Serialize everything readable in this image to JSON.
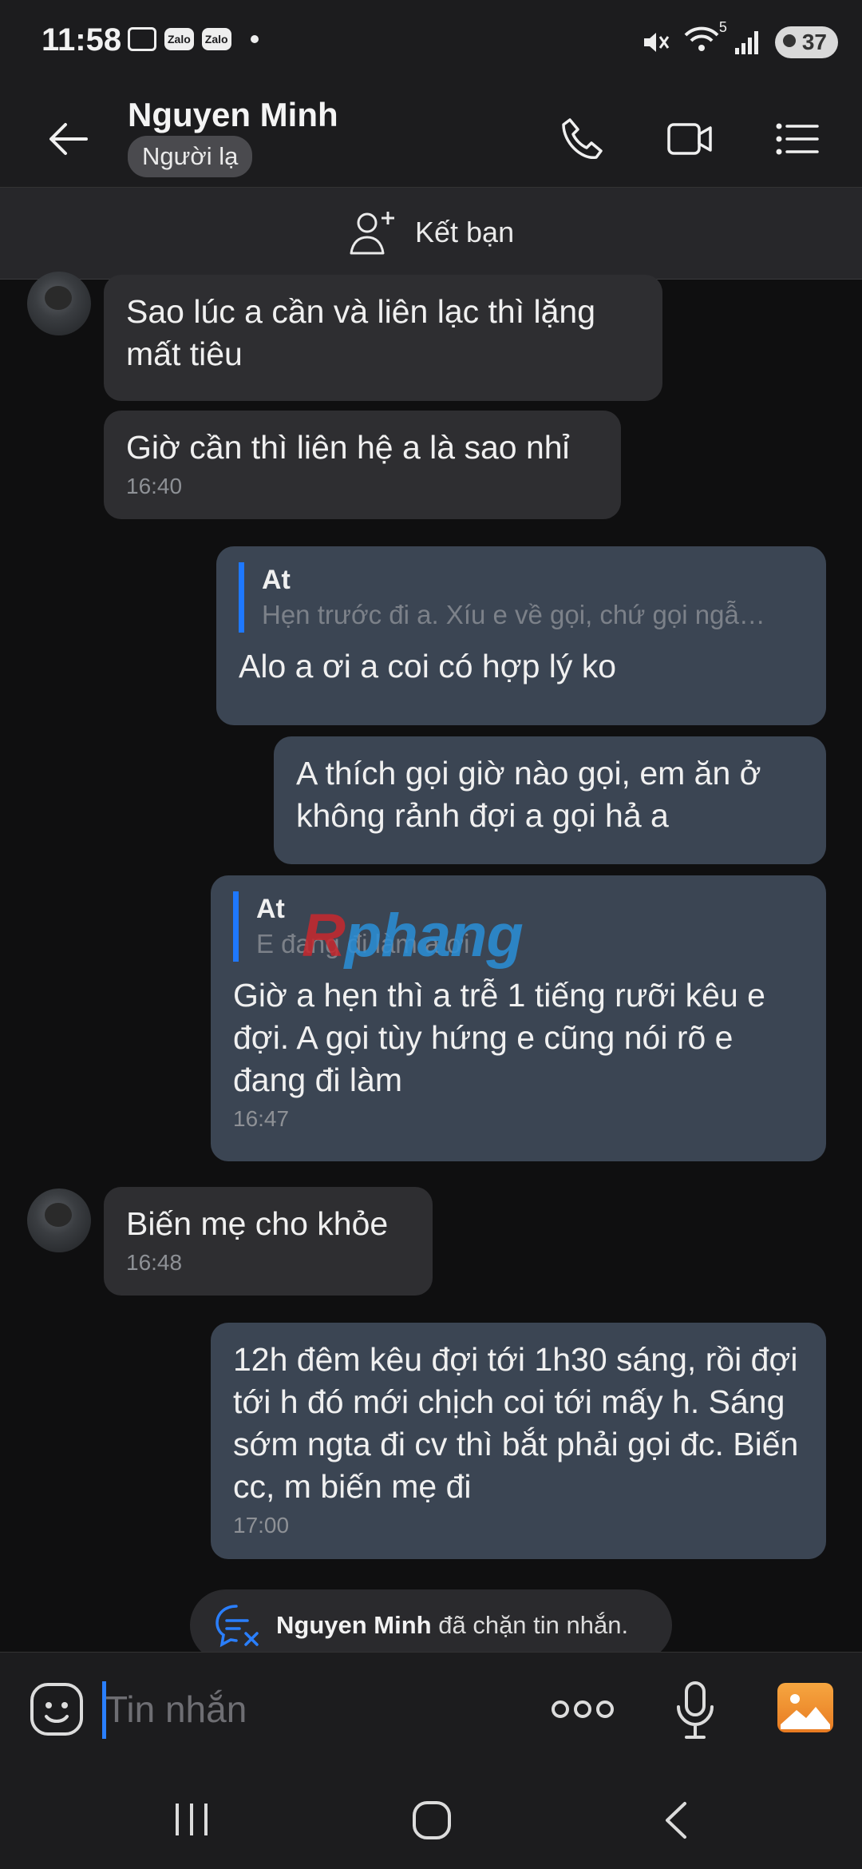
{
  "status_bar": {
    "time": "11:58",
    "app_badges": [
      "Zalo",
      "Zalo"
    ],
    "network": "5",
    "battery": "37"
  },
  "header": {
    "contact_name": "Nguyen Minh",
    "stranger_tag": "Người lạ",
    "icons": [
      "back-arrow-icon",
      "phone-icon",
      "video-call-icon",
      "menu-list-icon"
    ]
  },
  "add_friend": {
    "label": "Kết bạn",
    "icon": "add-user-icon"
  },
  "messages": [
    {
      "side": "in",
      "text": "Sao lúc a cần và liên lạc thì lặng mất tiêu"
    },
    {
      "side": "in",
      "text": "Giờ cần thì liên hệ a là sao nhỉ",
      "time": "16:40"
    },
    {
      "side": "out",
      "quote_name": "At",
      "quote_text": "Hẹn trước đi a. Xíu e về gọi, chứ gọi ngẫ…",
      "text": "Alo a ơi a coi có hợp lý ko"
    },
    {
      "side": "out",
      "text": "A thích gọi giờ nào gọi, em ăn ở không rảnh đợi a gọi hả a"
    },
    {
      "side": "out",
      "quote_name": "At",
      "quote_text": "E đang đi làm a ơi",
      "text": "Giờ a hẹn thì a trễ 1 tiếng rưỡi kêu e đợi. A gọi tùy hứng e cũng nói rõ e đang đi làm",
      "time": "16:47"
    },
    {
      "side": "in",
      "text": "Biến mẹ cho khỏe",
      "time": "16:48"
    },
    {
      "side": "out",
      "text": "12h đêm kêu đợi tới 1h30 sáng, rồi đợi tới h đó mới chịch coi tới mấy h. Sáng sớm ngta đi cv thì bắt phải gọi đc. Biến cc, m biến mẹ đi",
      "time": "17:00"
    }
  ],
  "blocked_notice": {
    "name": "Nguyen Minh",
    "text": "đã chặn tin nhắn."
  },
  "watermark": {
    "part1": "R",
    "part2": "phang"
  },
  "input": {
    "placeholder": "Tin nhắn",
    "icons": [
      "sticker-icon",
      "more-icon",
      "microphone-icon",
      "gallery-icon"
    ]
  },
  "navigation": [
    "recent-apps-icon",
    "home-icon",
    "back-icon"
  ],
  "colors": {
    "accent": "#1e78ff",
    "incoming_bubble": "#2e2e31",
    "outgoing_bubble": "#3b4553"
  }
}
